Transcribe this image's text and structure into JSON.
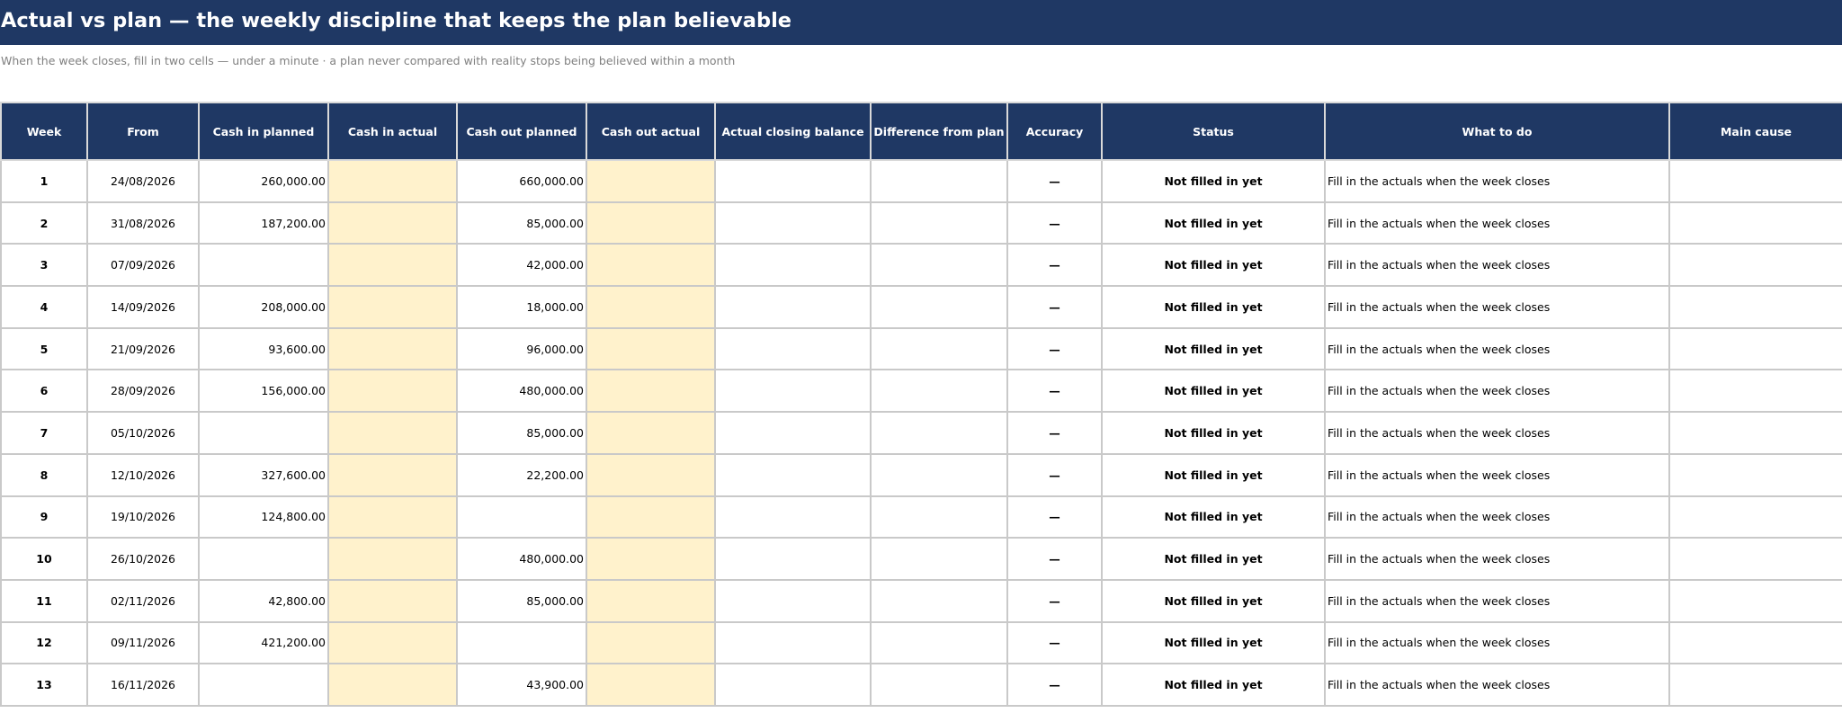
{
  "title": "Actual vs plan — the weekly discipline that keeps the plan believable",
  "subtitle": "When the week closes, fill in two cells — under a minute · a plan never compared with reality stops being believed within a month",
  "colors": {
    "header_bg": "#1f3864",
    "input_cell_bg": "#fff2cc",
    "grid_line": "#c9c9c9",
    "muted_text": "#7f7f7f"
  },
  "columns": [
    "Week",
    "From",
    "Cash in planned",
    "Cash in actual",
    "Cash out planned",
    "Cash out actual",
    "Actual closing balance",
    "Difference from plan",
    "Accuracy",
    "Status",
    "What to do",
    "Main cause"
  ],
  "rows": [
    {
      "week": "1",
      "from": "24/08/2026",
      "cash_in_planned": "260,000.00",
      "cash_in_actual": "",
      "cash_out_planned": "660,000.00",
      "cash_out_actual": "",
      "closing": "",
      "difference": "",
      "accuracy": "—",
      "status": "Not filled in yet",
      "todo": "Fill in the actuals when the week closes",
      "cause": ""
    },
    {
      "week": "2",
      "from": "31/08/2026",
      "cash_in_planned": "187,200.00",
      "cash_in_actual": "",
      "cash_out_planned": "85,000.00",
      "cash_out_actual": "",
      "closing": "",
      "difference": "",
      "accuracy": "—",
      "status": "Not filled in yet",
      "todo": "Fill in the actuals when the week closes",
      "cause": ""
    },
    {
      "week": "3",
      "from": "07/09/2026",
      "cash_in_planned": "",
      "cash_in_actual": "",
      "cash_out_planned": "42,000.00",
      "cash_out_actual": "",
      "closing": "",
      "difference": "",
      "accuracy": "—",
      "status": "Not filled in yet",
      "todo": "Fill in the actuals when the week closes",
      "cause": ""
    },
    {
      "week": "4",
      "from": "14/09/2026",
      "cash_in_planned": "208,000.00",
      "cash_in_actual": "",
      "cash_out_planned": "18,000.00",
      "cash_out_actual": "",
      "closing": "",
      "difference": "",
      "accuracy": "—",
      "status": "Not filled in yet",
      "todo": "Fill in the actuals when the week closes",
      "cause": ""
    },
    {
      "week": "5",
      "from": "21/09/2026",
      "cash_in_planned": "93,600.00",
      "cash_in_actual": "",
      "cash_out_planned": "96,000.00",
      "cash_out_actual": "",
      "closing": "",
      "difference": "",
      "accuracy": "—",
      "status": "Not filled in yet",
      "todo": "Fill in the actuals when the week closes",
      "cause": ""
    },
    {
      "week": "6",
      "from": "28/09/2026",
      "cash_in_planned": "156,000.00",
      "cash_in_actual": "",
      "cash_out_planned": "480,000.00",
      "cash_out_actual": "",
      "closing": "",
      "difference": "",
      "accuracy": "—",
      "status": "Not filled in yet",
      "todo": "Fill in the actuals when the week closes",
      "cause": ""
    },
    {
      "week": "7",
      "from": "05/10/2026",
      "cash_in_planned": "",
      "cash_in_actual": "",
      "cash_out_planned": "85,000.00",
      "cash_out_actual": "",
      "closing": "",
      "difference": "",
      "accuracy": "—",
      "status": "Not filled in yet",
      "todo": "Fill in the actuals when the week closes",
      "cause": ""
    },
    {
      "week": "8",
      "from": "12/10/2026",
      "cash_in_planned": "327,600.00",
      "cash_in_actual": "",
      "cash_out_planned": "22,200.00",
      "cash_out_actual": "",
      "closing": "",
      "difference": "",
      "accuracy": "—",
      "status": "Not filled in yet",
      "todo": "Fill in the actuals when the week closes",
      "cause": ""
    },
    {
      "week": "9",
      "from": "19/10/2026",
      "cash_in_planned": "124,800.00",
      "cash_in_actual": "",
      "cash_out_planned": "",
      "cash_out_actual": "",
      "closing": "",
      "difference": "",
      "accuracy": "—",
      "status": "Not filled in yet",
      "todo": "Fill in the actuals when the week closes",
      "cause": ""
    },
    {
      "week": "10",
      "from": "26/10/2026",
      "cash_in_planned": "",
      "cash_in_actual": "",
      "cash_out_planned": "480,000.00",
      "cash_out_actual": "",
      "closing": "",
      "difference": "",
      "accuracy": "—",
      "status": "Not filled in yet",
      "todo": "Fill in the actuals when the week closes",
      "cause": ""
    },
    {
      "week": "11",
      "from": "02/11/2026",
      "cash_in_planned": "42,800.00",
      "cash_in_actual": "",
      "cash_out_planned": "85,000.00",
      "cash_out_actual": "",
      "closing": "",
      "difference": "",
      "accuracy": "—",
      "status": "Not filled in yet",
      "todo": "Fill in the actuals when the week closes",
      "cause": ""
    },
    {
      "week": "12",
      "from": "09/11/2026",
      "cash_in_planned": "421,200.00",
      "cash_in_actual": "",
      "cash_out_planned": "",
      "cash_out_actual": "",
      "closing": "",
      "difference": "",
      "accuracy": "—",
      "status": "Not filled in yet",
      "todo": "Fill in the actuals when the week closes",
      "cause": ""
    },
    {
      "week": "13",
      "from": "16/11/2026",
      "cash_in_planned": "",
      "cash_in_actual": "",
      "cash_out_planned": "43,900.00",
      "cash_out_actual": "",
      "closing": "",
      "difference": "",
      "accuracy": "—",
      "status": "Not filled in yet",
      "todo": "Fill in the actuals when the week closes",
      "cause": ""
    }
  ]
}
